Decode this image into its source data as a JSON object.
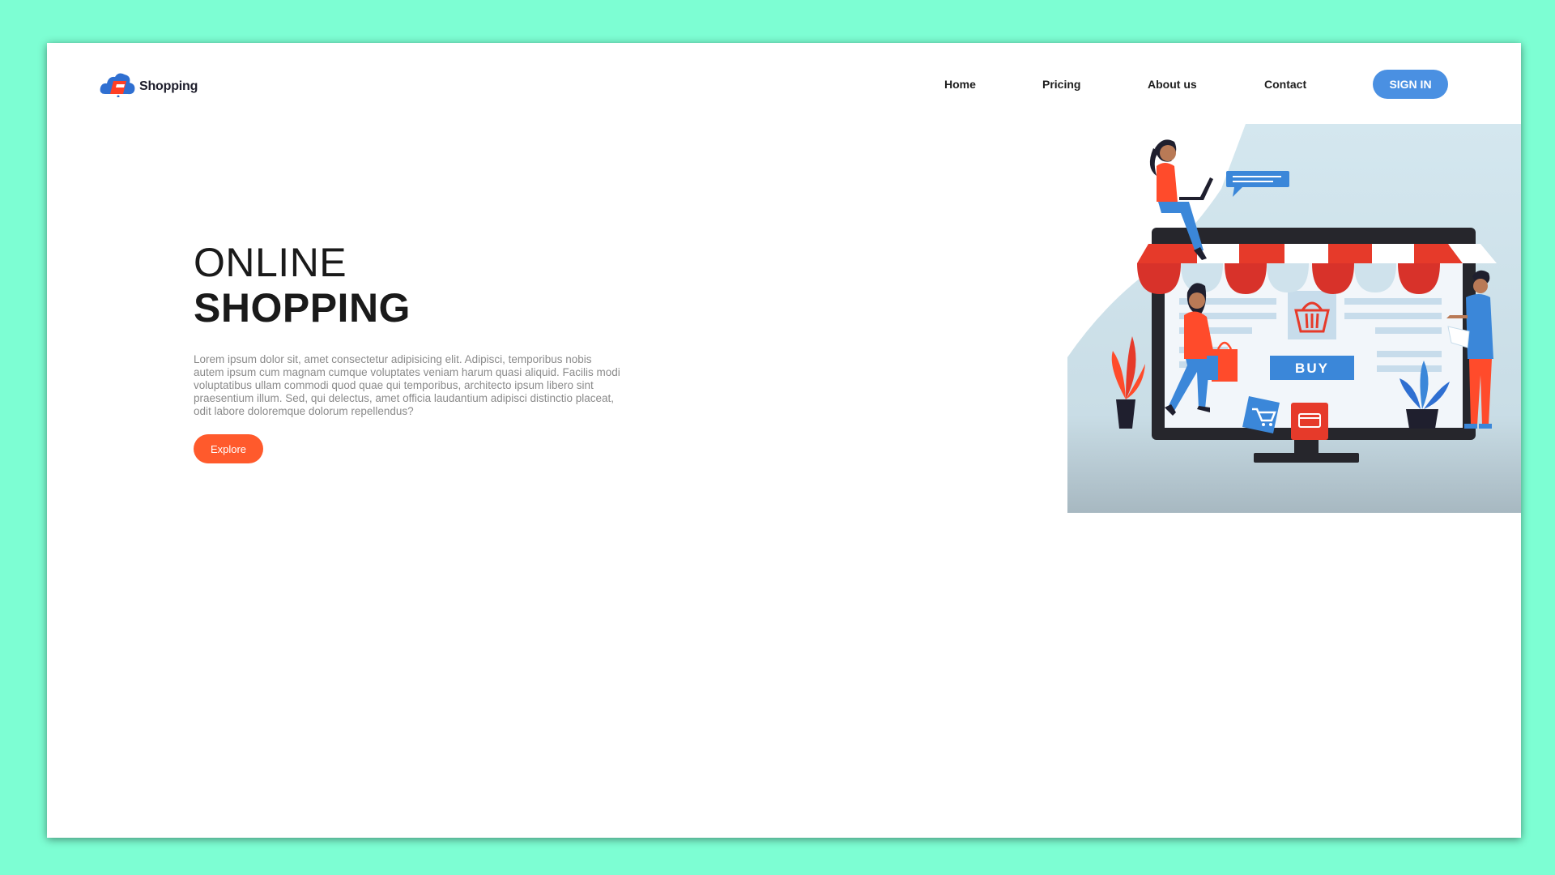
{
  "logo": {
    "text": "Shopping"
  },
  "nav": {
    "items": [
      {
        "label": "Home"
      },
      {
        "label": "Pricing"
      },
      {
        "label": "About us"
      },
      {
        "label": "Contact"
      }
    ],
    "signin_label": "SIGN IN"
  },
  "hero": {
    "title_line1": "ONLINE",
    "title_line2": "SHOPPING",
    "description": "Lorem ipsum dolor sit, amet consectetur adipisicing elit. Adipisci, temporibus nobis autem ipsum cum magnam cumque voluptates veniam harum quasi aliquid. Facilis modi voluptatibus ullam commodi quod quae qui temporibus, architecto ipsum libero sint praesentium illum. Sed, qui delectus, amet officia laudantium adipisci distinctio placeat, odit labore doloremque dolorum repellendus?",
    "cta_label": "Explore"
  },
  "illustration": {
    "buy_label": "BUY"
  },
  "colors": {
    "background": "#7dfed3",
    "accent_blue": "#4a90e2",
    "accent_orange": "#ff5a2c",
    "awning_red": "#e63a2a"
  }
}
